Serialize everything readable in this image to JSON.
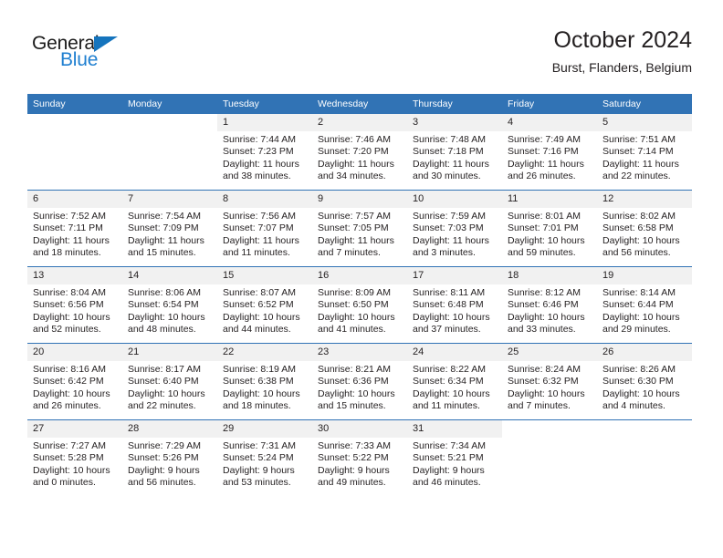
{
  "brand": {
    "name_top": "General",
    "name_bottom": "Blue",
    "triangle_color": "#1574bd",
    "blue_color": "#1f7fd0"
  },
  "header": {
    "title": "October 2024",
    "subtitle": "Burst, Flanders, Belgium"
  },
  "theme": {
    "header_blue": "#3173b5",
    "daynum_bg": "#f1f1f1",
    "text": "#231f20"
  },
  "weekday_headers": [
    "Sunday",
    "Monday",
    "Tuesday",
    "Wednesday",
    "Thursday",
    "Friday",
    "Saturday"
  ],
  "labels": {
    "sunrise_prefix": "Sunrise:",
    "sunset_prefix": "Sunset:",
    "daylight_prefix": "Daylight:"
  },
  "weeks": [
    [
      {
        "day": "",
        "sunrise": "",
        "sunset": "",
        "daylight_line1": "",
        "daylight_line2": "",
        "blank": true
      },
      {
        "day": "",
        "sunrise": "",
        "sunset": "",
        "daylight_line1": "",
        "daylight_line2": "",
        "blank": true
      },
      {
        "day": "1",
        "sunrise": "Sunrise: 7:44 AM",
        "sunset": "Sunset: 7:23 PM",
        "daylight_line1": "Daylight: 11 hours",
        "daylight_line2": "and 38 minutes."
      },
      {
        "day": "2",
        "sunrise": "Sunrise: 7:46 AM",
        "sunset": "Sunset: 7:20 PM",
        "daylight_line1": "Daylight: 11 hours",
        "daylight_line2": "and 34 minutes."
      },
      {
        "day": "3",
        "sunrise": "Sunrise: 7:48 AM",
        "sunset": "Sunset: 7:18 PM",
        "daylight_line1": "Daylight: 11 hours",
        "daylight_line2": "and 30 minutes."
      },
      {
        "day": "4",
        "sunrise": "Sunrise: 7:49 AM",
        "sunset": "Sunset: 7:16 PM",
        "daylight_line1": "Daylight: 11 hours",
        "daylight_line2": "and 26 minutes."
      },
      {
        "day": "5",
        "sunrise": "Sunrise: 7:51 AM",
        "sunset": "Sunset: 7:14 PM",
        "daylight_line1": "Daylight: 11 hours",
        "daylight_line2": "and 22 minutes."
      }
    ],
    [
      {
        "day": "6",
        "sunrise": "Sunrise: 7:52 AM",
        "sunset": "Sunset: 7:11 PM",
        "daylight_line1": "Daylight: 11 hours",
        "daylight_line2": "and 18 minutes."
      },
      {
        "day": "7",
        "sunrise": "Sunrise: 7:54 AM",
        "sunset": "Sunset: 7:09 PM",
        "daylight_line1": "Daylight: 11 hours",
        "daylight_line2": "and 15 minutes."
      },
      {
        "day": "8",
        "sunrise": "Sunrise: 7:56 AM",
        "sunset": "Sunset: 7:07 PM",
        "daylight_line1": "Daylight: 11 hours",
        "daylight_line2": "and 11 minutes."
      },
      {
        "day": "9",
        "sunrise": "Sunrise: 7:57 AM",
        "sunset": "Sunset: 7:05 PM",
        "daylight_line1": "Daylight: 11 hours",
        "daylight_line2": "and 7 minutes."
      },
      {
        "day": "10",
        "sunrise": "Sunrise: 7:59 AM",
        "sunset": "Sunset: 7:03 PM",
        "daylight_line1": "Daylight: 11 hours",
        "daylight_line2": "and 3 minutes."
      },
      {
        "day": "11",
        "sunrise": "Sunrise: 8:01 AM",
        "sunset": "Sunset: 7:01 PM",
        "daylight_line1": "Daylight: 10 hours",
        "daylight_line2": "and 59 minutes."
      },
      {
        "day": "12",
        "sunrise": "Sunrise: 8:02 AM",
        "sunset": "Sunset: 6:58 PM",
        "daylight_line1": "Daylight: 10 hours",
        "daylight_line2": "and 56 minutes."
      }
    ],
    [
      {
        "day": "13",
        "sunrise": "Sunrise: 8:04 AM",
        "sunset": "Sunset: 6:56 PM",
        "daylight_line1": "Daylight: 10 hours",
        "daylight_line2": "and 52 minutes."
      },
      {
        "day": "14",
        "sunrise": "Sunrise: 8:06 AM",
        "sunset": "Sunset: 6:54 PM",
        "daylight_line1": "Daylight: 10 hours",
        "daylight_line2": "and 48 minutes."
      },
      {
        "day": "15",
        "sunrise": "Sunrise: 8:07 AM",
        "sunset": "Sunset: 6:52 PM",
        "daylight_line1": "Daylight: 10 hours",
        "daylight_line2": "and 44 minutes."
      },
      {
        "day": "16",
        "sunrise": "Sunrise: 8:09 AM",
        "sunset": "Sunset: 6:50 PM",
        "daylight_line1": "Daylight: 10 hours",
        "daylight_line2": "and 41 minutes."
      },
      {
        "day": "17",
        "sunrise": "Sunrise: 8:11 AM",
        "sunset": "Sunset: 6:48 PM",
        "daylight_line1": "Daylight: 10 hours",
        "daylight_line2": "and 37 minutes."
      },
      {
        "day": "18",
        "sunrise": "Sunrise: 8:12 AM",
        "sunset": "Sunset: 6:46 PM",
        "daylight_line1": "Daylight: 10 hours",
        "daylight_line2": "and 33 minutes."
      },
      {
        "day": "19",
        "sunrise": "Sunrise: 8:14 AM",
        "sunset": "Sunset: 6:44 PM",
        "daylight_line1": "Daylight: 10 hours",
        "daylight_line2": "and 29 minutes."
      }
    ],
    [
      {
        "day": "20",
        "sunrise": "Sunrise: 8:16 AM",
        "sunset": "Sunset: 6:42 PM",
        "daylight_line1": "Daylight: 10 hours",
        "daylight_line2": "and 26 minutes."
      },
      {
        "day": "21",
        "sunrise": "Sunrise: 8:17 AM",
        "sunset": "Sunset: 6:40 PM",
        "daylight_line1": "Daylight: 10 hours",
        "daylight_line2": "and 22 minutes."
      },
      {
        "day": "22",
        "sunrise": "Sunrise: 8:19 AM",
        "sunset": "Sunset: 6:38 PM",
        "daylight_line1": "Daylight: 10 hours",
        "daylight_line2": "and 18 minutes."
      },
      {
        "day": "23",
        "sunrise": "Sunrise: 8:21 AM",
        "sunset": "Sunset: 6:36 PM",
        "daylight_line1": "Daylight: 10 hours",
        "daylight_line2": "and 15 minutes."
      },
      {
        "day": "24",
        "sunrise": "Sunrise: 8:22 AM",
        "sunset": "Sunset: 6:34 PM",
        "daylight_line1": "Daylight: 10 hours",
        "daylight_line2": "and 11 minutes."
      },
      {
        "day": "25",
        "sunrise": "Sunrise: 8:24 AM",
        "sunset": "Sunset: 6:32 PM",
        "daylight_line1": "Daylight: 10 hours",
        "daylight_line2": "and 7 minutes."
      },
      {
        "day": "26",
        "sunrise": "Sunrise: 8:26 AM",
        "sunset": "Sunset: 6:30 PM",
        "daylight_line1": "Daylight: 10 hours",
        "daylight_line2": "and 4 minutes."
      }
    ],
    [
      {
        "day": "27",
        "sunrise": "Sunrise: 7:27 AM",
        "sunset": "Sunset: 5:28 PM",
        "daylight_line1": "Daylight: 10 hours",
        "daylight_line2": "and 0 minutes."
      },
      {
        "day": "28",
        "sunrise": "Sunrise: 7:29 AM",
        "sunset": "Sunset: 5:26 PM",
        "daylight_line1": "Daylight: 9 hours",
        "daylight_line2": "and 56 minutes."
      },
      {
        "day": "29",
        "sunrise": "Sunrise: 7:31 AM",
        "sunset": "Sunset: 5:24 PM",
        "daylight_line1": "Daylight: 9 hours",
        "daylight_line2": "and 53 minutes."
      },
      {
        "day": "30",
        "sunrise": "Sunrise: 7:33 AM",
        "sunset": "Sunset: 5:22 PM",
        "daylight_line1": "Daylight: 9 hours",
        "daylight_line2": "and 49 minutes."
      },
      {
        "day": "31",
        "sunrise": "Sunrise: 7:34 AM",
        "sunset": "Sunset: 5:21 PM",
        "daylight_line1": "Daylight: 9 hours",
        "daylight_line2": "and 46 minutes."
      },
      {
        "day": "",
        "sunrise": "",
        "sunset": "",
        "daylight_line1": "",
        "daylight_line2": "",
        "blank": true
      },
      {
        "day": "",
        "sunrise": "",
        "sunset": "",
        "daylight_line1": "",
        "daylight_line2": "",
        "blank": true
      }
    ]
  ]
}
